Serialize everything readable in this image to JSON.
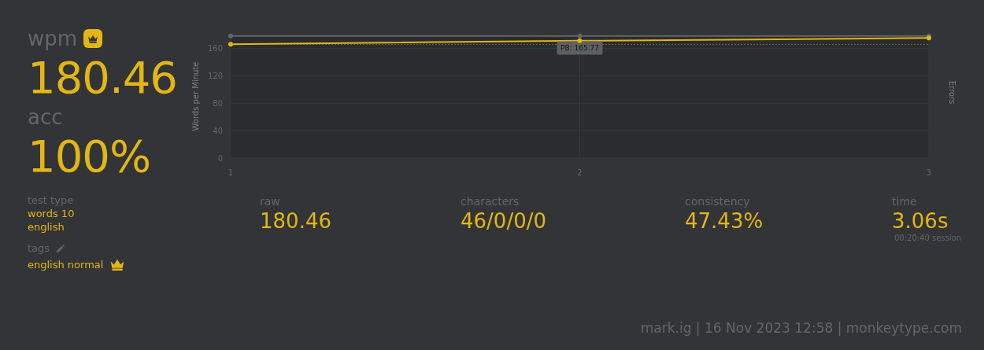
{
  "results": {
    "wpm": {
      "label": "wpm",
      "value": "180.46",
      "personal_best": true
    },
    "acc": {
      "label": "acc",
      "value": "100%"
    },
    "test_type": {
      "label": "test type",
      "lines": [
        "words 10",
        "english"
      ]
    },
    "tags": {
      "label": "tags",
      "items": [
        {
          "name": "english normal",
          "personal_best": true
        }
      ]
    }
  },
  "chart": {
    "secondary_axis_label": "Errors",
    "chart_data": {
      "type": "line",
      "ylabel": "Words per Minute",
      "x": [
        1,
        2,
        3
      ],
      "series": [
        {
          "color": "#e2b714",
          "values": [
            166,
            171,
            175
          ],
          "marker": "circle"
        },
        {
          "color": "#646669",
          "values": [
            178,
            178,
            178
          ],
          "marker": "circle"
        }
      ],
      "xlim": [
        1,
        3
      ],
      "ylim": [
        0,
        180
      ],
      "yticks": [
        0,
        40,
        80,
        120,
        160
      ],
      "xticks": [
        1,
        2,
        3
      ],
      "grid": true,
      "ref_lines": [
        {
          "axis": "y",
          "value": 165.77,
          "label": "PB: 165.77"
        }
      ]
    }
  },
  "stats": [
    {
      "label": "raw",
      "value": "180.46"
    },
    {
      "label": "characters",
      "value": "46/0/0/0"
    },
    {
      "label": "consistency",
      "value": "47.43%"
    },
    {
      "label": "time",
      "value": "3.06s",
      "note": "00:20:40 session"
    }
  ],
  "footer": "mark.ig | 16 Nov 2023 12:58 | monkeytype.com"
}
